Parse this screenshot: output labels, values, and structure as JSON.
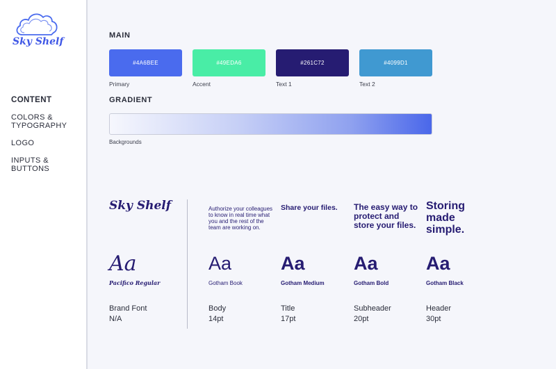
{
  "app": {
    "logo_text": "Sky Shelf"
  },
  "sidebar": {
    "items": [
      {
        "label": "CONTENT"
      },
      {
        "label": "COLORS & TYPOGRAPHY"
      },
      {
        "label": "LOGO"
      },
      {
        "label": "INPUTS & BUTTONS"
      }
    ]
  },
  "colors": {
    "main_title": "MAIN",
    "swatches": [
      {
        "hex": "#4A6BEE",
        "label": "Primary",
        "color": "#4A6BEE"
      },
      {
        "hex": "#49EDA6",
        "label": "Accent",
        "color": "#49EDA6"
      },
      {
        "hex": "#261C72",
        "label": "Text 1",
        "color": "#261C72"
      },
      {
        "hex": "#4099D1",
        "label": "Text 2",
        "color": "#4099D1"
      }
    ],
    "gradient_title": "GRADIENT",
    "gradient_label": "Backgrounds"
  },
  "typography": {
    "brand": {
      "logo": "Sky Shelf",
      "sample": "Aa",
      "font_name": "Pacifico Regular",
      "role": "Brand Font",
      "size": "N/A"
    },
    "styles": [
      {
        "sample_text": "Authorize your colleagues to know in real time what you and the rest of the team are working on.",
        "sample": "Aa",
        "font_name": "Gotham Book",
        "role": "Body",
        "size": "14pt"
      },
      {
        "sample_text": "Share your files.",
        "sample": "Aa",
        "font_name": "Gotham Medium",
        "role": "Title",
        "size": "17pt"
      },
      {
        "sample_text": "The easy way to protect and store your files.",
        "sample": "Aa",
        "font_name": "Gotham Bold",
        "role": "Subheader",
        "size": "20pt"
      },
      {
        "sample_text": "Storing made simple.",
        "sample": "Aa",
        "font_name": "Gotham Black",
        "role": "Header",
        "size": "30pt"
      }
    ]
  }
}
